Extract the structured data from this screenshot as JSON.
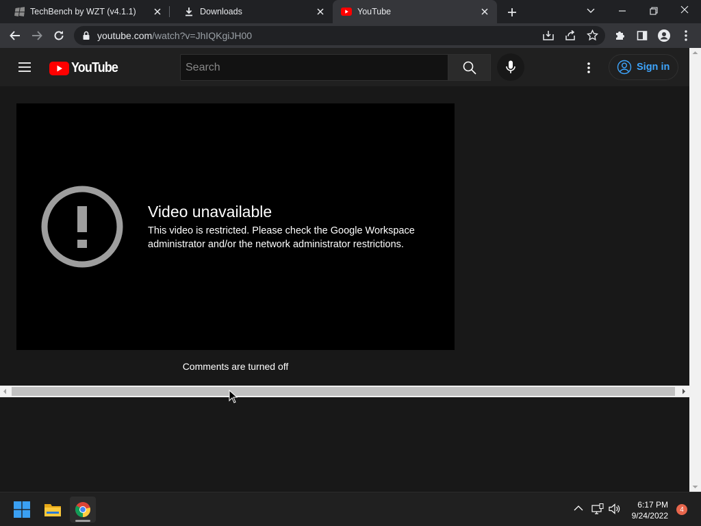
{
  "browser": {
    "tabs": [
      {
        "title": "TechBench by WZT (v4.1.1)",
        "icon": "windows-logo-icon",
        "active": false
      },
      {
        "title": "Downloads",
        "icon": "download-icon",
        "active": false
      },
      {
        "title": "YouTube",
        "icon": "youtube-icon",
        "active": true
      }
    ],
    "url_host": "youtube.com",
    "url_path": "/watch?v=JhIQKgiJH00"
  },
  "youtube": {
    "logo_text": "YouTube",
    "search_placeholder": "Search",
    "sign_in_label": "Sign in",
    "player": {
      "error_title": "Video unavailable",
      "error_message": "This video is restricted. Please check the Google Workspace administrator and/or the network administrator restrictions."
    },
    "comments_status": "Comments are turned off"
  },
  "taskbar": {
    "time": "6:17 PM",
    "date": "9/24/2022",
    "notification_count": "4"
  },
  "colors": {
    "youtube_red": "#ff0000",
    "sign_in_blue": "#3ea6ff",
    "notification_badge": "#e8664c"
  }
}
